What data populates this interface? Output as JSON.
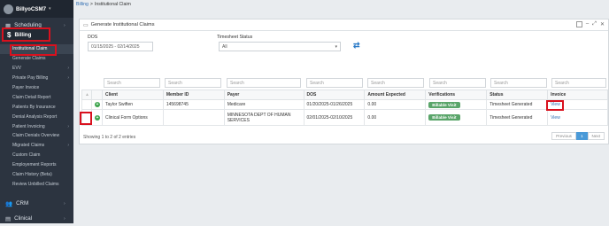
{
  "sidebar": {
    "user": "BillyoCSM7",
    "scheduling": "Scheduling",
    "billing": "Billing",
    "items": [
      "Institutional Claim",
      "Generate Claims",
      "EVV",
      "Private Pay Billing",
      "Payer Invoice",
      "Claim Detail Report",
      "Patients By Insurance",
      "Denial Analysis Report",
      "Patient Invoicing",
      "Claim Denials Overview",
      "Migrated Claims",
      "Custom Claim",
      "Employement Reports",
      "Claim History (Beta)",
      "Review Unbilled Claims"
    ],
    "crm": "CRM",
    "clinical": "Clinical"
  },
  "breadcrumb": {
    "root": "Billing",
    "sep": ">",
    "current": "Institutional Claim"
  },
  "panel": {
    "title": "Generate Institutional Claims",
    "dos_label": "DOS",
    "dos_value": "01/15/2025 - 02/14/2025",
    "status_label": "Timesheet Status",
    "status_value": "All",
    "search_placeholder": "Search"
  },
  "table": {
    "headers": [
      "Client",
      "Member ID",
      "Payer",
      "DOS",
      "Amount Expected",
      "Verifications",
      "Status",
      "Invoice"
    ],
    "rows": [
      {
        "client": "Taylor Swiften",
        "member_id": "145698745",
        "payer": "Medicare",
        "dos": "01/20/2025-01/26/2025",
        "amount": "0.00",
        "verification": "Billable Visit",
        "status": "Timesheet Generated",
        "invoice": "View"
      },
      {
        "client": "Clinical Form Options",
        "member_id": "",
        "payer": "MINNESOTA DEPT OF HUMAN SERVICES",
        "dos": "02/01/2025-02/10/2025",
        "amount": "0.00",
        "verification": "Billable Visit",
        "status": "Timesheet Generated",
        "invoice": "View"
      }
    ],
    "footer": "Showing 1 to 2 of 2 entries",
    "pager": {
      "prev": "Previous",
      "page": "1",
      "next": "Next"
    }
  },
  "colors": {
    "sidebar": "#2c3440",
    "accent_red": "#d9111e",
    "badge": "#5aa56a",
    "link": "#2f6db2"
  }
}
